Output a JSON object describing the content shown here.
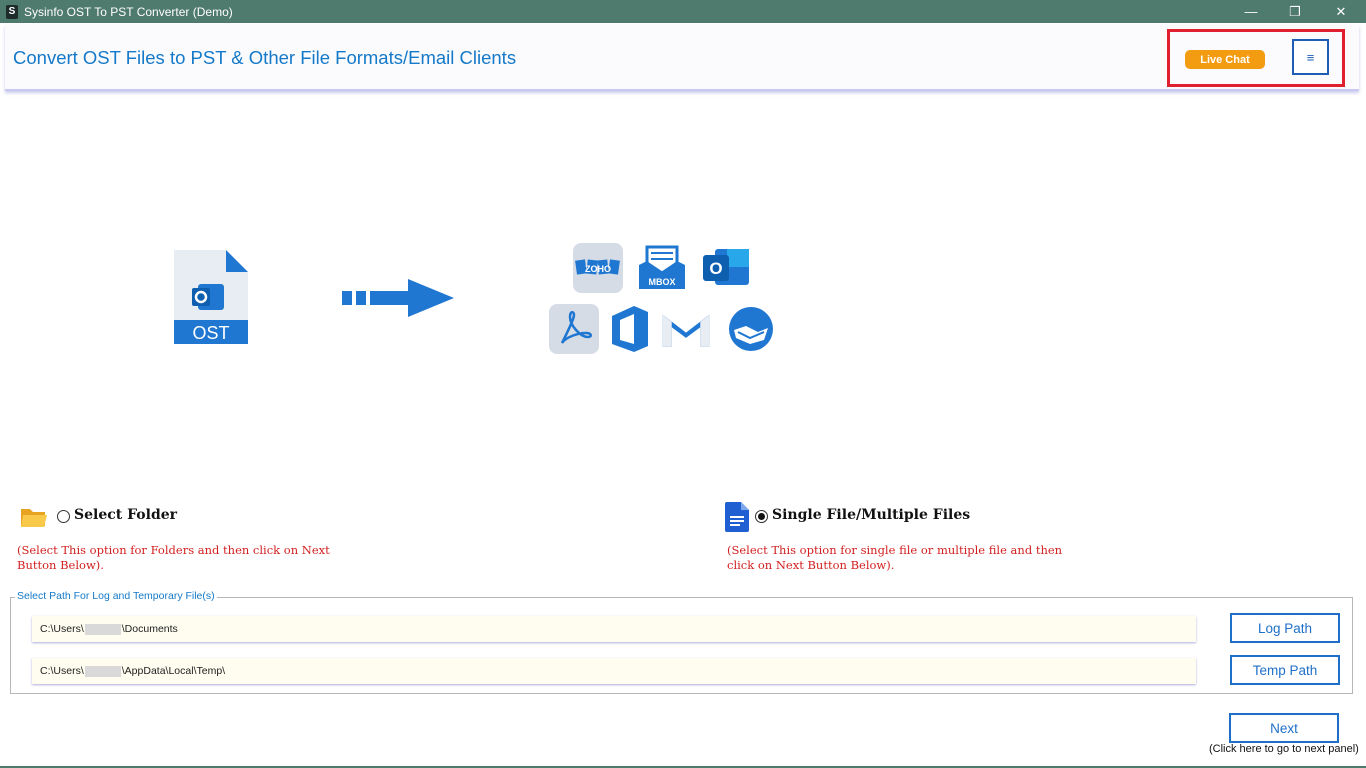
{
  "window": {
    "title": "Sysinfo OST To PST Converter (Demo)",
    "app_icon_letter": "S",
    "controls": {
      "minimize": "—",
      "maximize": "❐",
      "close": "✕"
    }
  },
  "header": {
    "title": "Convert OST Files to PST & Other File Formats/Email Clients",
    "live_chat_label": "Live Chat",
    "menu_icon": "≡"
  },
  "illustration": {
    "source_label": "OST",
    "targets": [
      "zoho-icon",
      "mbox-icon",
      "outlook-icon",
      "pdf-icon",
      "office365-icon",
      "gmail-icon",
      "thunderbird-icon"
    ],
    "zoho_text": "ZOHO",
    "mbox_text": "MBOX",
    "outlook_letter": "O"
  },
  "options": {
    "folder": {
      "label": "Select Folder",
      "hint_line1": "(Select This option for Folders and then click on Next",
      "hint_line2": "Button Below).",
      "selected": false
    },
    "files": {
      "label": "Single File/Multiple Files",
      "hint_line1": "(Select This option for single file or multiple file and then",
      "hint_line2": "click on Next Button Below).",
      "selected": true
    }
  },
  "paths": {
    "legend": "Select Path For Log and Temporary File(s)",
    "log_prefix": "C:\\Users\\",
    "log_suffix": "\\Documents",
    "temp_prefix": "C:\\Users\\",
    "temp_suffix": "\\AppData\\Local\\Temp\\",
    "log_button": "Log Path",
    "temp_button": "Temp Path"
  },
  "footer": {
    "next_label": "Next",
    "next_hint": "(Click here to go to next panel)"
  },
  "colors": {
    "title_bar": "#4f7a6e",
    "accent_blue": "#1479c8",
    "live_chat": "#f39c12",
    "highlight_red": "#e0202e",
    "hint_red": "#d21f1f"
  }
}
